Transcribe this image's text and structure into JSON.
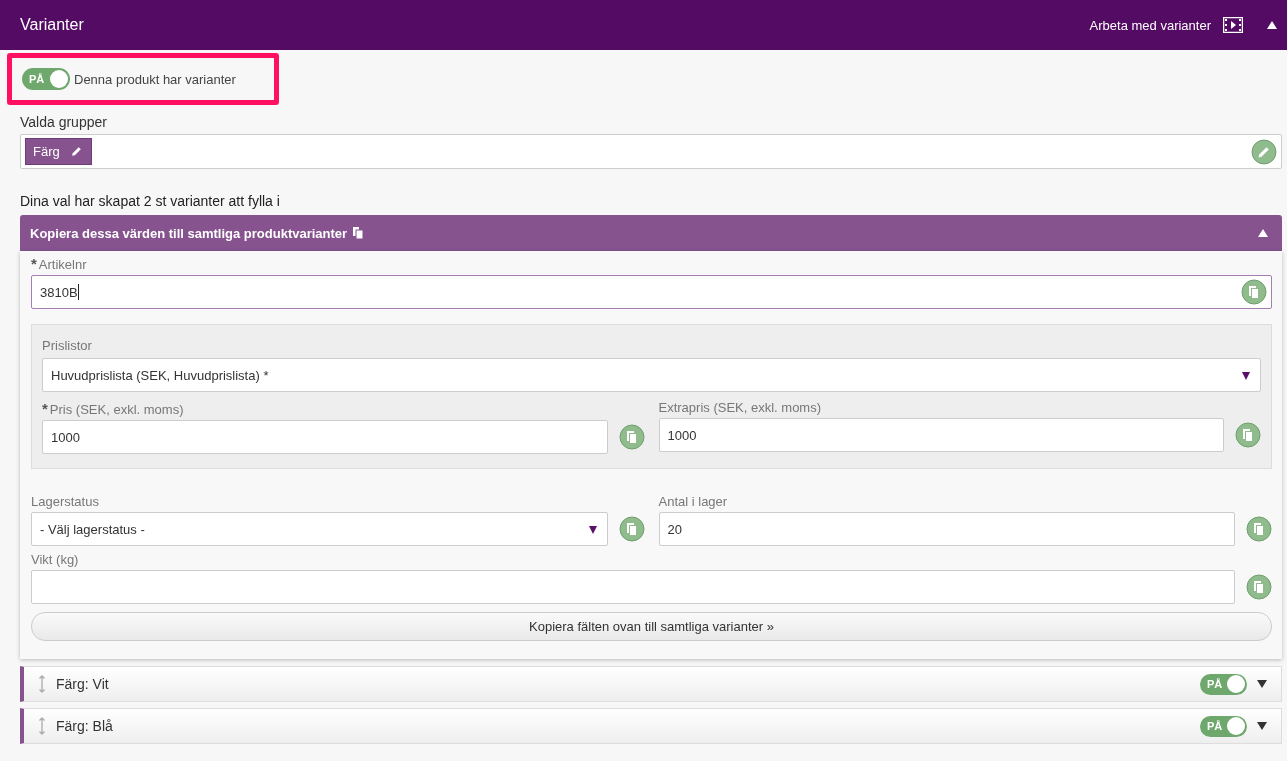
{
  "header": {
    "title": "Varianter",
    "link_label": "Arbeta med varianter",
    "expanded": true
  },
  "variant_toggle": {
    "on": true,
    "on_label": "PÅ",
    "label": "Denna produkt har varianter"
  },
  "groups": {
    "label": "Valda grupper",
    "tags": [
      {
        "label": "Färg"
      }
    ]
  },
  "summary": "Dina val har skapat 2 st varianter att fylla i",
  "copy_section": {
    "title": "Kopiera dessa värden till samtliga produktvarianter",
    "expanded": true,
    "article": {
      "required_mark": "*",
      "label": "Artikelnr",
      "value": "3810B",
      "focused": true
    },
    "pricelists": {
      "label": "Prislistor",
      "select": {
        "value": "Huvudprislista (SEK, Huvudprislista) *"
      },
      "price": {
        "required_mark": "*",
        "label": "Pris (SEK, exkl. moms)",
        "value": "1000"
      },
      "extra_price": {
        "label": "Extrapris (SEK, exkl. moms)",
        "value": "1000"
      }
    },
    "stock_status": {
      "label": "Lagerstatus",
      "value": "- Välj lagerstatus -"
    },
    "stock_quantity": {
      "label": "Antal i lager",
      "value": "20"
    },
    "weight": {
      "label": "Vikt (kg)"
    },
    "copy_button": "Kopiera fälten ovan till samtliga varianter »"
  },
  "variants": [
    {
      "label": "Färg: Vit",
      "on": true,
      "on_label": "PÅ",
      "expanded": false
    },
    {
      "label": "Färg: Blå",
      "on": true,
      "on_label": "PÅ",
      "expanded": false
    }
  ]
}
